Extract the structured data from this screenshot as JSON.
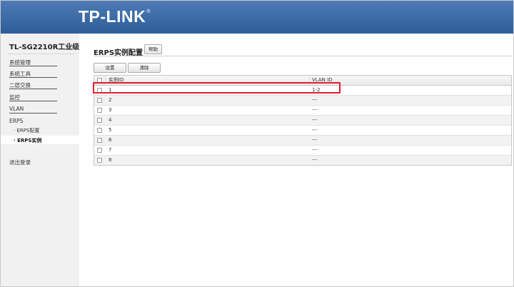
{
  "header": {
    "logo": "TP-LINK",
    "logo_mark": "®"
  },
  "sidebar": {
    "model": "TL-SG2210R工业级",
    "items": [
      {
        "label": "系统管理"
      },
      {
        "label": "系统工具"
      },
      {
        "label": "二层交换"
      },
      {
        "label": "监控"
      },
      {
        "label": "VLAN"
      },
      {
        "label": "ERPS"
      }
    ],
    "subitems": [
      {
        "label": "· ERPS配置"
      },
      {
        "label": "· ERPS实例"
      }
    ],
    "logout": "退出登录"
  },
  "main": {
    "title": "ERPS实例配置",
    "help_label": "帮助",
    "buttons": {
      "set": "设置",
      "clear": "清除"
    },
    "table": {
      "headers": {
        "id": "实例ID",
        "vlan": "VLAN ID"
      },
      "rows": [
        {
          "id": "1",
          "vlan": "1-2"
        },
        {
          "id": "2",
          "vlan": "---"
        },
        {
          "id": "3",
          "vlan": "---"
        },
        {
          "id": "4",
          "vlan": "---"
        },
        {
          "id": "5",
          "vlan": "---"
        },
        {
          "id": "6",
          "vlan": "---"
        },
        {
          "id": "7",
          "vlan": "---"
        },
        {
          "id": "8",
          "vlan": "---"
        }
      ]
    }
  },
  "colors": {
    "header_blue": "#3b6aa6",
    "highlight_red": "#e01f2a"
  }
}
